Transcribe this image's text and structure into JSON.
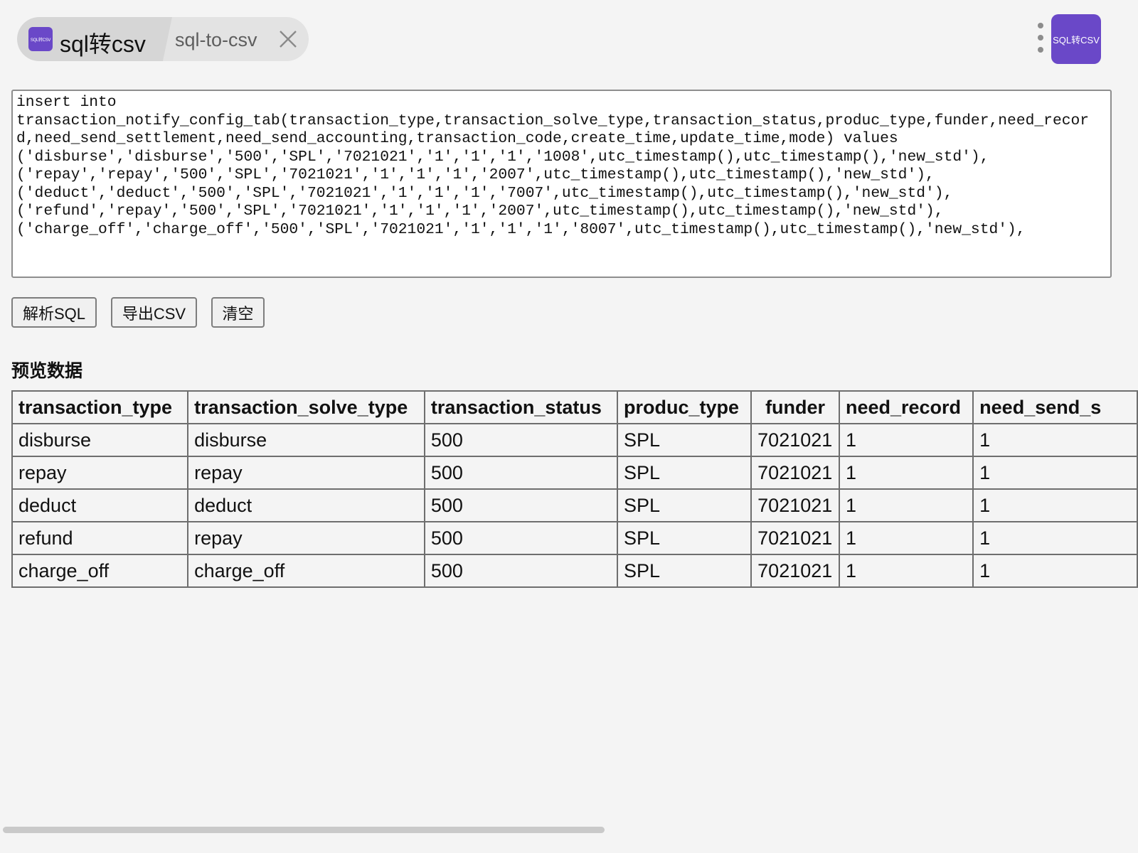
{
  "tab": {
    "logo_text": "SQL转CSV",
    "title": "sql转csv",
    "subtitle": "sql-to-csv"
  },
  "app_badge": "SQL转CSV",
  "sql_input": {
    "value": "insert into\ntransaction_notify_config_tab(transaction_type,transaction_solve_type,transaction_status,produc_type,funder,need_record,need_send_settlement,need_send_accounting,transaction_code,create_time,update_time,mode) values\n('disburse','disburse','500','SPL','7021021','1','1','1','1008',utc_timestamp(),utc_timestamp(),'new_std'),\n('repay','repay','500','SPL','7021021','1','1','1','2007',utc_timestamp(),utc_timestamp(),'new_std'),\n('deduct','deduct','500','SPL','7021021','1','1','1','7007',utc_timestamp(),utc_timestamp(),'new_std'),\n('refund','repay','500','SPL','7021021','1','1','1','2007',utc_timestamp(),utc_timestamp(),'new_std'),\n('charge_off','charge_off','500','SPL','7021021','1','1','1','8007',utc_timestamp(),utc_timestamp(),'new_std'),"
  },
  "buttons": {
    "parse": "解析SQL",
    "export": "导出CSV",
    "clear": "清空"
  },
  "preview": {
    "title": "预览数据",
    "columns": [
      "transaction_type",
      "transaction_solve_type",
      "transaction_status",
      "produc_type",
      "funder",
      "need_record",
      "need_send_s"
    ],
    "rows": [
      [
        "disburse",
        "disburse",
        "500",
        "SPL",
        "7021021",
        "1",
        "1"
      ],
      [
        "repay",
        "repay",
        "500",
        "SPL",
        "7021021",
        "1",
        "1"
      ],
      [
        "deduct",
        "deduct",
        "500",
        "SPL",
        "7021021",
        "1",
        "1"
      ],
      [
        "refund",
        "repay",
        "500",
        "SPL",
        "7021021",
        "1",
        "1"
      ],
      [
        "charge_off",
        "charge_off",
        "500",
        "SPL",
        "7021021",
        "1",
        "1"
      ]
    ]
  },
  "colors": {
    "accent": "#6a48c8",
    "background": "#f4f4f4"
  }
}
